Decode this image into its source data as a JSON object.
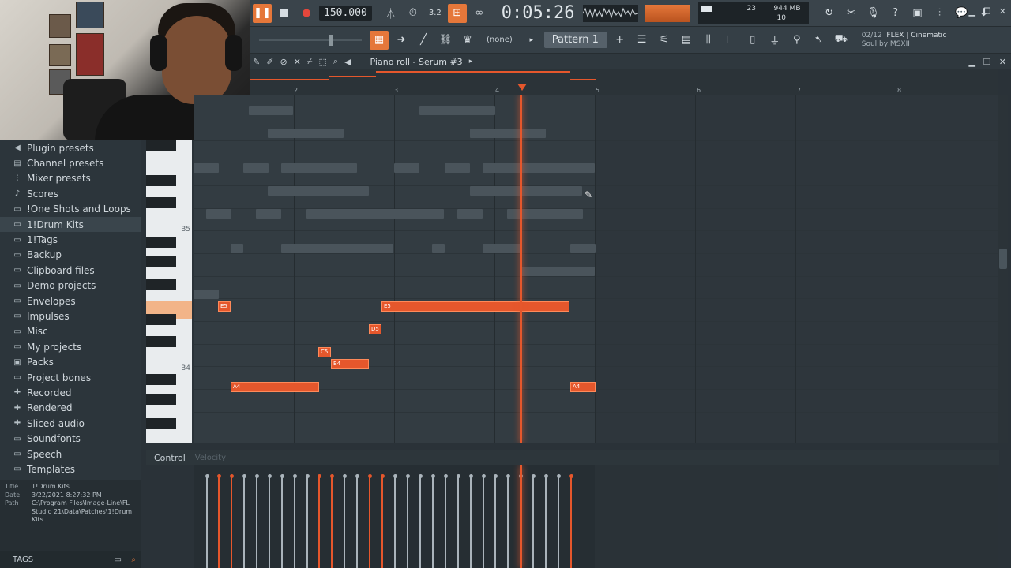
{
  "toolbar": {
    "bpm": "150.000",
    "time": "0:05:26",
    "cpu_count": "23",
    "ram": "944 MB",
    "poly": "10",
    "pattern": "Pattern 1",
    "none_label": "(none)",
    "song_position": "02/12",
    "song_title": "FLEX | Cinematic",
    "song_author": "Soul by MSXII",
    "mode_3d": "3.2"
  },
  "piano_roll": {
    "title": "Piano roll - Serum #3",
    "ruler": [
      "2",
      "3",
      "4",
      "5",
      "6",
      "7",
      "8"
    ],
    "key_labels": [
      "B5",
      "B4"
    ],
    "notes": [
      {
        "label": "E5"
      },
      {
        "label": "E5"
      },
      {
        "label": "D5"
      },
      {
        "label": "C5"
      },
      {
        "label": "B4"
      },
      {
        "label": "A4"
      },
      {
        "label": "A4"
      }
    ]
  },
  "control": {
    "label": "Control",
    "param": "Velocity"
  },
  "browser": {
    "items": [
      {
        "label": "Plugin presets",
        "icon": "plugin-icon"
      },
      {
        "label": "Channel presets",
        "icon": "channel-icon"
      },
      {
        "label": "Mixer presets",
        "icon": "mixer-icon"
      },
      {
        "label": "Scores",
        "icon": "note-icon"
      },
      {
        "label": "!One Shots and Loops",
        "icon": "folder-icon"
      },
      {
        "label": "1!Drum Kits",
        "icon": "folder-icon"
      },
      {
        "label": "1!Tags",
        "icon": "folder-icon"
      },
      {
        "label": "Backup",
        "icon": "folder-icon"
      },
      {
        "label": "Clipboard files",
        "icon": "folder-icon"
      },
      {
        "label": "Demo projects",
        "icon": "folder-icon"
      },
      {
        "label": "Envelopes",
        "icon": "folder-icon"
      },
      {
        "label": "Impulses",
        "icon": "folder-icon"
      },
      {
        "label": "Misc",
        "icon": "folder-icon"
      },
      {
        "label": "My projects",
        "icon": "folder-icon"
      },
      {
        "label": "Packs",
        "icon": "packs-icon"
      },
      {
        "label": "Project bones",
        "icon": "folder-icon"
      },
      {
        "label": "Recorded",
        "icon": "recorded-icon"
      },
      {
        "label": "Rendered",
        "icon": "rendered-icon"
      },
      {
        "label": "Sliced audio",
        "icon": "sliced-icon"
      },
      {
        "label": "Soundfonts",
        "icon": "folder-icon"
      },
      {
        "label": "Speech",
        "icon": "folder-icon"
      },
      {
        "label": "Templates",
        "icon": "folder-icon"
      }
    ],
    "hint": {
      "title_label": "Title",
      "title_value": "1!Drum Kits",
      "date_label": "Date",
      "date_value": "3/22/2021 8:27:32 PM",
      "path_label": "Path",
      "path_value": "C:\\Program Files\\Image-Line\\FL Studio 21\\Data\\Patches\\1!Drum Kits"
    },
    "tags_label": "TAGS"
  },
  "colors": {
    "accent": "#e5572c",
    "background": "#333c42"
  }
}
